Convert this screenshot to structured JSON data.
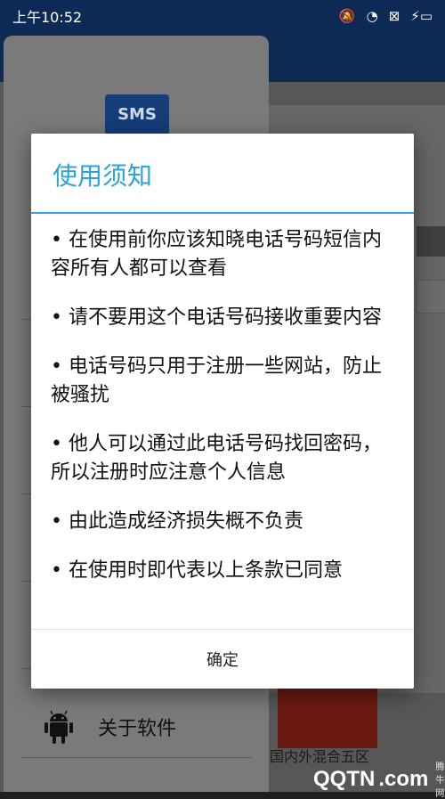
{
  "status_bar": {
    "time": "上午10:52",
    "icons": [
      "mute-icon",
      "wifi-icon",
      "sim-icon",
      "battery-charging-icon"
    ],
    "icon_glyphs": {
      "mute": "🔕",
      "wifi": "◔",
      "sim": "⊠",
      "battery": "⚡▭"
    }
  },
  "drawer": {
    "logo_text": "SMS",
    "items": [
      {
        "label": "关于软件",
        "icon": "android-icon"
      }
    ]
  },
  "background": {
    "bottom_text": "国内外混合五区"
  },
  "dialog": {
    "title": "使用须知",
    "items": [
      "• 在使用前你应该知晓电话号码短信内容所有人都可以查看",
      "• 请不要用这个电话号码接收重要内容",
      "• 电话号码只用于注册一些网站，防止被骚扰",
      "• 他人可以通过此电话号码找回密码，所以注册时应注意个人信息",
      "• 由此造成经济损失概不负责",
      "• 在使用时即代表以上条款已同意"
    ],
    "confirm_label": "确定"
  },
  "watermark": {
    "brand": "QQTN",
    "suffix": ".com",
    "small": "腾牛网"
  },
  "colors": {
    "accent": "#2aa3d6",
    "status_bar": "#0c2a55"
  }
}
